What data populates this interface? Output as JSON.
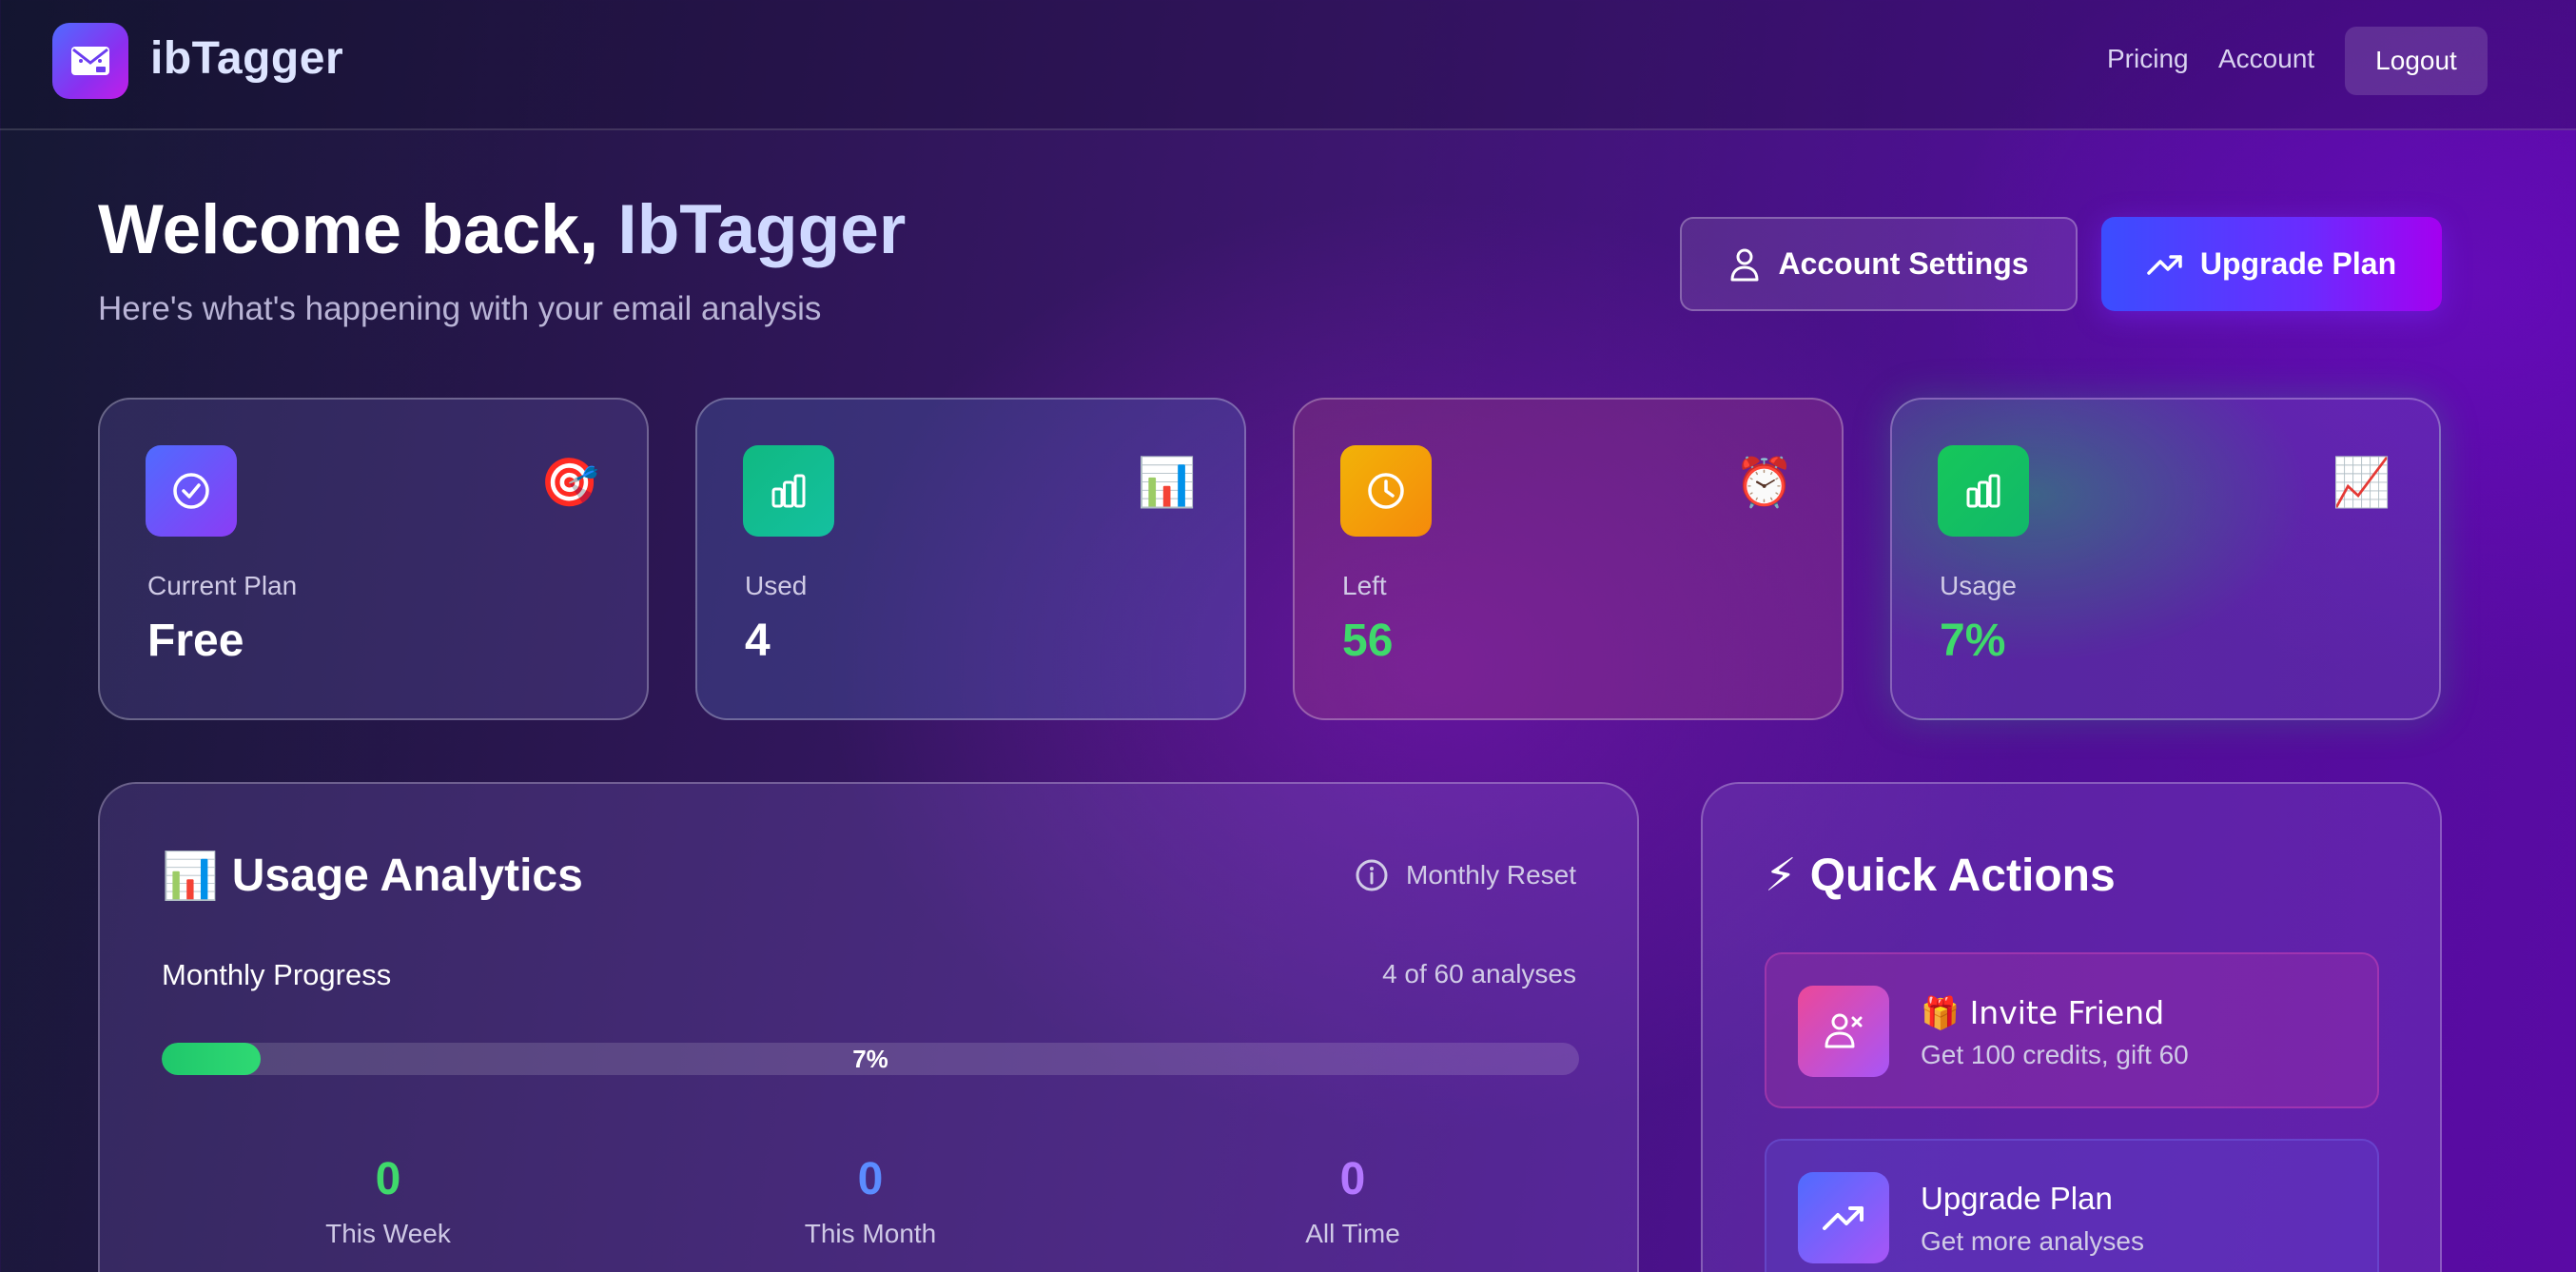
{
  "header": {
    "brand": "ibTagger",
    "nav": {
      "pricing": "Pricing",
      "account": "Account",
      "logout": "Logout"
    }
  },
  "welcome": {
    "prefix": "Welcome back, ",
    "username": "IbTagger",
    "subtitle": "Here's what's happening with your email analysis",
    "account_settings": "Account Settings",
    "upgrade_plan": "Upgrade Plan"
  },
  "stats": [
    {
      "label": "Current Plan",
      "value": "Free",
      "icon": "check-circle-icon",
      "emoji": "🎯"
    },
    {
      "label": "Used",
      "value": "4",
      "icon": "bar-chart-icon",
      "emoji": "📊"
    },
    {
      "label": "Left",
      "value": "56",
      "icon": "clock-icon",
      "emoji": "⏰"
    },
    {
      "label": "Usage",
      "value": "7%",
      "icon": "bar-chart-icon",
      "emoji": "📈"
    }
  ],
  "analytics": {
    "emoji": "📊",
    "title": "Usage Analytics",
    "reset_label": "Monthly Reset",
    "progress_label": "Monthly Progress",
    "progress_count": "4 of 60 analyses",
    "progress_percent": 7,
    "progress_text": "7%",
    "week": {
      "value": "0",
      "label": "This Week"
    },
    "month": {
      "value": "0",
      "label": "This Month"
    },
    "all_time": {
      "value": "0",
      "label": "All Time"
    }
  },
  "quick_actions": {
    "emoji": "⚡",
    "title": "Quick Actions",
    "items": [
      {
        "title": "🎁 Invite Friend",
        "subtitle": "Get 100 credits, gift 60"
      },
      {
        "title": "Upgrade Plan",
        "subtitle": "Get more analyses"
      }
    ]
  },
  "colors": {
    "accent_green": "#3fd96b",
    "accent_blue": "#5b8cff",
    "accent_purple": "#b377ff",
    "brand_gradient_start": "#3b4dff",
    "brand_gradient_end": "#a400f0"
  }
}
